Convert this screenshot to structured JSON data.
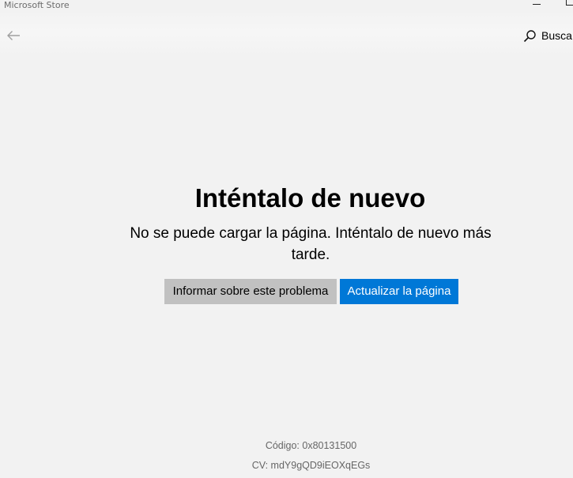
{
  "window": {
    "title": "Microsoft Store"
  },
  "navbar": {
    "back_icon": "arrow-left-icon",
    "search_icon": "search-icon",
    "search_label": "Busca"
  },
  "error": {
    "title": "Inténtalo de nuevo",
    "message": "No se puede cargar la página. Inténtalo de nuevo más tarde.",
    "code": "Código: 0x80131500",
    "cv": "CV: mdY9gQD9iEOXqEGs"
  },
  "actions": {
    "report_label": "Informar sobre este problema",
    "refresh_label": "Actualizar la página"
  },
  "colors": {
    "background": "#f2f2f2",
    "accent": "#0078d7",
    "secondary_button": "#c1c1c1"
  }
}
